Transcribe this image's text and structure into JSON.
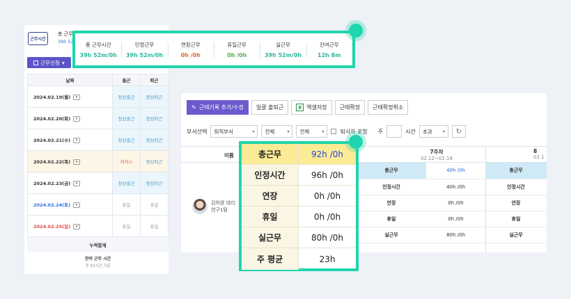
{
  "left": {
    "brand": "근무시간",
    "total_label": "총 근무",
    "total_value": "39h 52",
    "apply_button": "근무신청",
    "headers": {
      "date": "날짜",
      "in": "출근",
      "out": "퇴근"
    },
    "rows": [
      {
        "date": "2024.02.19(월)",
        "in": "정상출근",
        "out": "정상퇴근",
        "type": "normal"
      },
      {
        "date": "2024.02.20(화)",
        "in": "정상출근",
        "out": "정상퇴근",
        "type": "normal"
      },
      {
        "date": "2024.02.21(수)",
        "in": "정상출근",
        "out": "정상퇴근",
        "type": "normal"
      },
      {
        "date": "2024.02.22(목)",
        "in": "지각⚠",
        "out": "정상퇴근",
        "type": "late"
      },
      {
        "date": "2024.02.23(금)",
        "in": "정상출근",
        "out": "정상퇴근",
        "type": "normal"
      },
      {
        "date": "2024.02.24(토)",
        "in": "휴일",
        "out": "휴일",
        "type": "sat"
      },
      {
        "date": "2024.02.25(일)",
        "in": "휴일",
        "out": "휴일",
        "type": "sun"
      }
    ],
    "cumulative": "누적합계",
    "remaining": "잔여 근무 시간",
    "remaining_sub": "주 52시간 기준"
  },
  "summary": [
    {
      "label": "총 근무시간",
      "value": "39h 52m/0h",
      "color": "#2bb5a0"
    },
    {
      "label": "인정근무",
      "value": "39h 52m/0h",
      "color": "#2bb5a0"
    },
    {
      "label": "연장근무",
      "value": "0h /0h",
      "color": "#e8612d"
    },
    {
      "label": "휴일근무",
      "value": "0h /0h",
      "color": "#4caf50"
    },
    {
      "label": "실근무",
      "value": "39h 52m/0h",
      "color": "#2bb5a0"
    },
    {
      "label": "잔여근무",
      "value": "12h 8m",
      "color": "#2bb5a0"
    }
  ],
  "toolbar": {
    "add": "근태기록 추가/수정",
    "bulk": "일괄 출퇴근",
    "excel": "엑셀저장",
    "confirm": "근태확정",
    "cancel": "근태확정취소"
  },
  "filters": {
    "dept_label": "부서선택",
    "dept_value": "퇴직부서",
    "sel2": "전체",
    "sel3": "전체",
    "include_retired": "퇴사자 포함",
    "week_label": "주",
    "hours_label": "시간",
    "over_value": "초과"
  },
  "grid": {
    "name_header": "이름",
    "week7": "7주차",
    "week7_range": "02.12~02.18",
    "week8": "8",
    "week8_range": "02.1",
    "person_name": "김하광 대리",
    "person_team": "연구1팀",
    "week7_rows": [
      {
        "label": "총근무",
        "value": "40h /0h"
      },
      {
        "label": "인정시간",
        "value": "40h /0h"
      },
      {
        "label": "연장",
        "value": "0h /0h"
      },
      {
        "label": "휴일",
        "value": "0h /0h"
      },
      {
        "label": "실근무",
        "value": "80h /0h"
      }
    ],
    "week8_rows": [
      "총근무",
      "인정시간",
      "연장",
      "휴일",
      "실근무"
    ]
  },
  "stats": [
    {
      "label": "총근무",
      "value": "92h /0h"
    },
    {
      "label": "인정시간",
      "value": "96h /0h"
    },
    {
      "label": "연장",
      "value": "0h /0h"
    },
    {
      "label": "휴일",
      "value": "0h /0h"
    },
    {
      "label": "실근무",
      "value": "80h /0h"
    },
    {
      "label": "주 평균",
      "value": "23h"
    }
  ],
  "colors": {
    "accent": "#1fd5ad",
    "primary": "#6a5acd"
  }
}
